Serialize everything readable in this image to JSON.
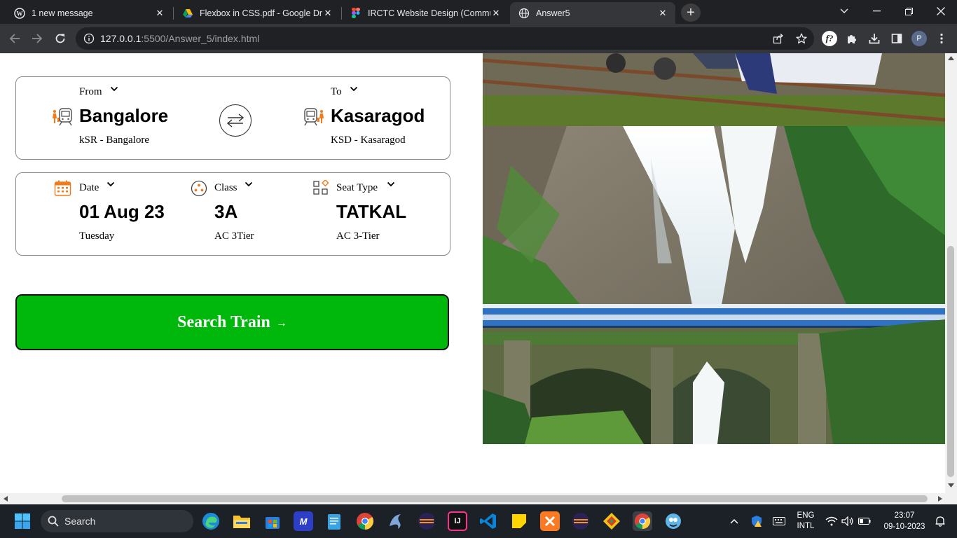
{
  "browser": {
    "tabs": [
      {
        "title": "1 new message",
        "favicon": "wordpress-icon",
        "active": false
      },
      {
        "title": "Flexbox in CSS.pdf - Google Driv",
        "favicon": "google-drive-icon",
        "active": false
      },
      {
        "title": "IRCTC Website Design (Commun",
        "favicon": "figma-icon",
        "active": false
      },
      {
        "title": "Answer5",
        "favicon": "globe-icon",
        "active": true
      }
    ],
    "url_host": "127.0.0.1",
    "url_path": ":5500/Answer_5/index.html",
    "profile_initial": "P"
  },
  "journey": {
    "from": {
      "label": "From",
      "city": "Bangalore",
      "station": "kSR - Bangalore"
    },
    "to": {
      "label": "To",
      "city": "Kasaragod",
      "station": "KSD - Kasaragod"
    }
  },
  "details": {
    "date": {
      "label": "Date",
      "value": "01 Aug 23",
      "sub": "Tuesday"
    },
    "class": {
      "label": "Class",
      "value": "3A",
      "sub": "AC 3Tier"
    },
    "seat": {
      "label": "Seat Type",
      "value": "TATKAL",
      "sub": "AC 3-Tier"
    }
  },
  "search_button": {
    "label": "Search Train",
    "arrow": "→"
  },
  "taskbar": {
    "search_placeholder": "Search",
    "lang": "ENG",
    "layout": "INTL",
    "time": "23:07",
    "date": "09-10-2023"
  },
  "colors": {
    "accent_green": "#00b70b",
    "icon_orange": "#f27a1a",
    "chrome_dark": "#202124",
    "chrome_toolbar": "#35363a"
  }
}
